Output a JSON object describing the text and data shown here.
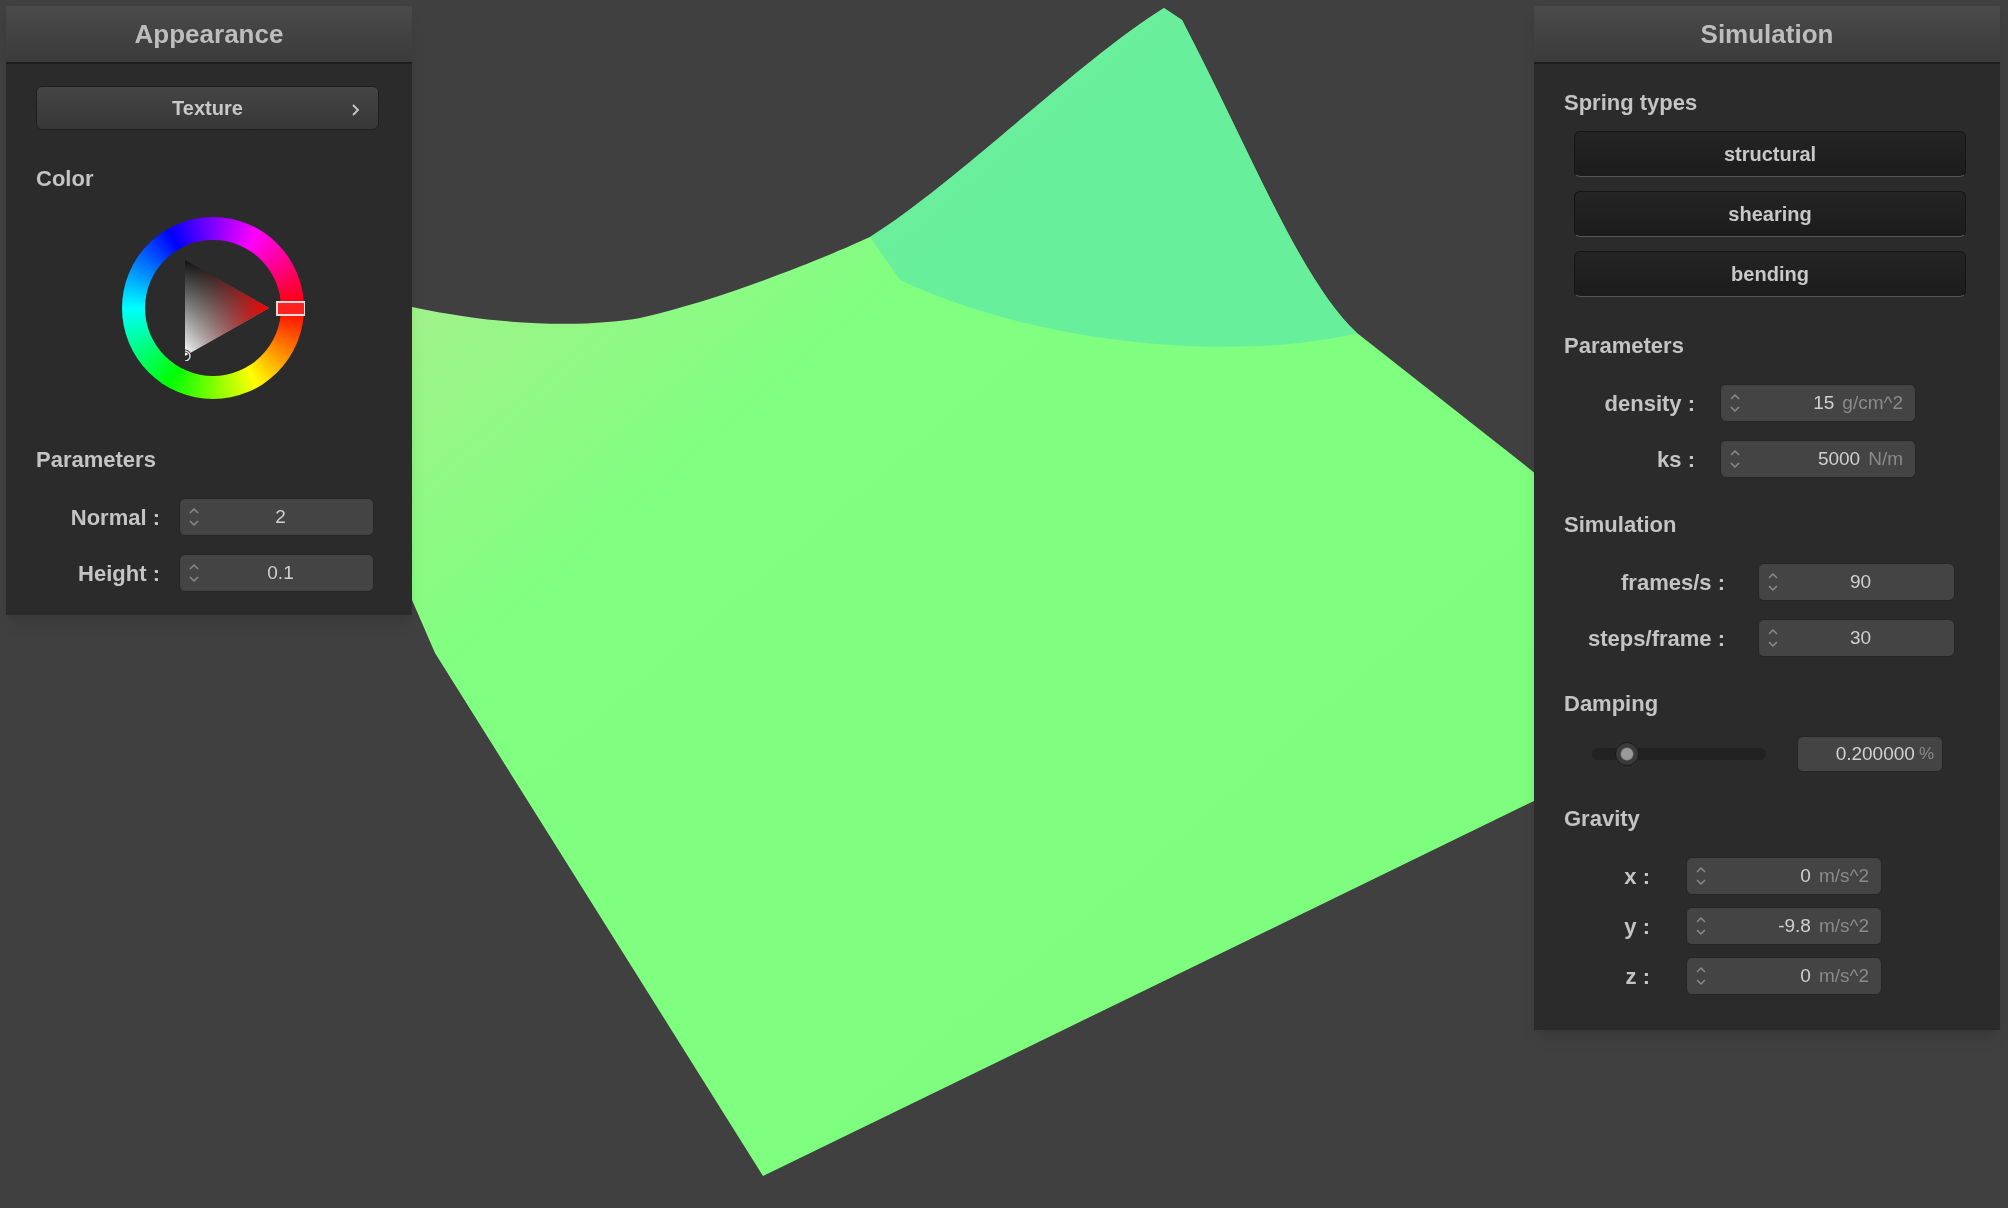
{
  "appearance": {
    "title": "Appearance",
    "texture_button": "Texture",
    "color_heading": "Color",
    "parameters_heading": "Parameters",
    "fields": [
      {
        "label": "Normal :",
        "value": "2"
      },
      {
        "label": "Height :",
        "value": "0.1"
      }
    ]
  },
  "simulation": {
    "title": "Simulation",
    "spring_heading": "Spring types",
    "spring_buttons": [
      "structural",
      "shearing",
      "bending"
    ],
    "parameters_heading": "Parameters",
    "parameters": [
      {
        "label": "density :",
        "value": "15",
        "unit": "g/cm^2"
      },
      {
        "label": "ks :",
        "value": "5000",
        "unit": "N/m"
      }
    ],
    "simulation_heading": "Simulation",
    "simulation_fields": [
      {
        "label": "frames/s :",
        "value": "90"
      },
      {
        "label": "steps/frame :",
        "value": "30"
      }
    ],
    "damping": {
      "heading": "Damping",
      "level": 0.2,
      "value": "0.200000",
      "unit": "%"
    },
    "gravity_heading": "Gravity",
    "gravity": [
      {
        "label": "x :",
        "value": "0",
        "unit": "m/s^2"
      },
      {
        "label": "y :",
        "value": "-9.8",
        "unit": "m/s^2"
      },
      {
        "label": "z :",
        "value": "0",
        "unit": "m/s^2"
      }
    ]
  }
}
